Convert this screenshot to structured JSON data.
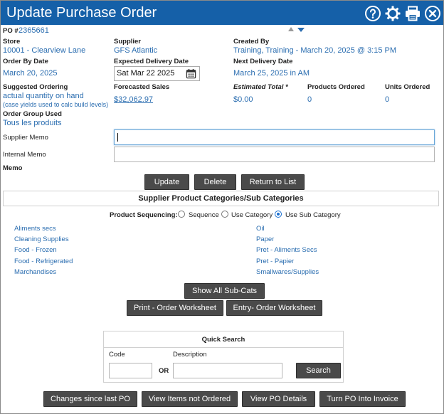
{
  "header": {
    "title": "Update Purchase Order",
    "icons": [
      "help-icon",
      "gear-icon",
      "print-icon",
      "close-icon"
    ],
    "bg_color": "#1560a8"
  },
  "po": {
    "label": "PO #",
    "number": "2365661"
  },
  "fields": {
    "store_label": "Store",
    "store_value": "10001 - Clearview Lane",
    "supplier_label": "Supplier",
    "supplier_value": "GFS Atlantic",
    "created_by_label": "Created By",
    "created_by_value": "Training, Training - March 20, 2025 @ 3:15 PM",
    "order_by_label": "Order By Date",
    "order_by_value": "March 20, 2025",
    "expected_label": "Expected Delivery Date",
    "expected_value": "Sat Mar 22 2025",
    "next_delivery_label": "Next Delivery Date",
    "next_delivery_value": "March 25, 2025 in AM",
    "suggested_label": "Suggested Ordering",
    "suggested_value": "actual quantity on hand",
    "suggested_note": "(case yields used to calc build levels)",
    "forecasted_label": "Forecasted Sales",
    "forecasted_value": "$32,062.97",
    "estimated_label": "Estimated Total *",
    "estimated_value": "$0.00",
    "products_label": "Products Ordered",
    "products_value": "0",
    "units_label": "Units Ordered",
    "units_value": "0",
    "group_label": "Order Group Used",
    "group_value": "Tous les produits"
  },
  "memos": {
    "supplier_label": "Supplier Memo",
    "supplier_value": "",
    "internal_label": "Internal Memo",
    "internal_value": "",
    "memo_label": "Memo"
  },
  "buttons": {
    "update": "Update",
    "delete": "Delete",
    "return": "Return to List",
    "show_all": "Show All Sub-Cats",
    "print_ws": "Print - Order Worksheet",
    "entry_ws": "Entry- Order Worksheet",
    "search": "Search",
    "changes": "Changes since last PO",
    "not_ordered": "View Items not Ordered",
    "details": "View PO Details",
    "invoice": "Turn PO Into Invoice"
  },
  "categories": {
    "header": "Supplier Product Categories/Sub Categories",
    "sequencing_label": "Product Sequencing:",
    "options": [
      "Sequence",
      "Use Category",
      "Use Sub Category"
    ],
    "selected": "Use Sub Category",
    "left": [
      "Aliments secs",
      "Cleaning Supplies",
      "Food - Frozen",
      "Food - Refrigerated",
      "Marchandises"
    ],
    "right": [
      "Oil",
      "Paper",
      "Pret - Aliments Secs",
      "Pret - Papier",
      "Smallwares/Supplies"
    ]
  },
  "quick_search": {
    "title": "Quick Search",
    "code_label": "Code",
    "or_label": "OR",
    "desc_label": "Description",
    "code_value": "",
    "desc_value": ""
  }
}
